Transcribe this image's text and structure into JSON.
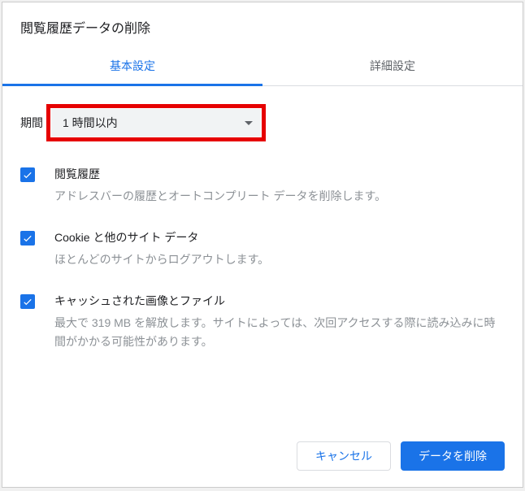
{
  "title": "閲覧履歴データの削除",
  "tabs": {
    "basic": "基本設定",
    "advanced": "詳細設定"
  },
  "period": {
    "label": "期間",
    "selected": "1 時間以内"
  },
  "options": [
    {
      "title": "閲覧履歴",
      "desc": "アドレスバーの履歴とオートコンプリート データを削除します。",
      "checked": true
    },
    {
      "title": "Cookie と他のサイト データ",
      "desc": "ほとんどのサイトからログアウトします。",
      "checked": true
    },
    {
      "title": "キャッシュされた画像とファイル",
      "desc": "最大で 319 MB を解放します。サイトによっては、次回アクセスする際に読み込みに時間がかかる可能性があります。",
      "checked": true
    }
  ],
  "buttons": {
    "cancel": "キャンセル",
    "confirm": "データを削除"
  }
}
